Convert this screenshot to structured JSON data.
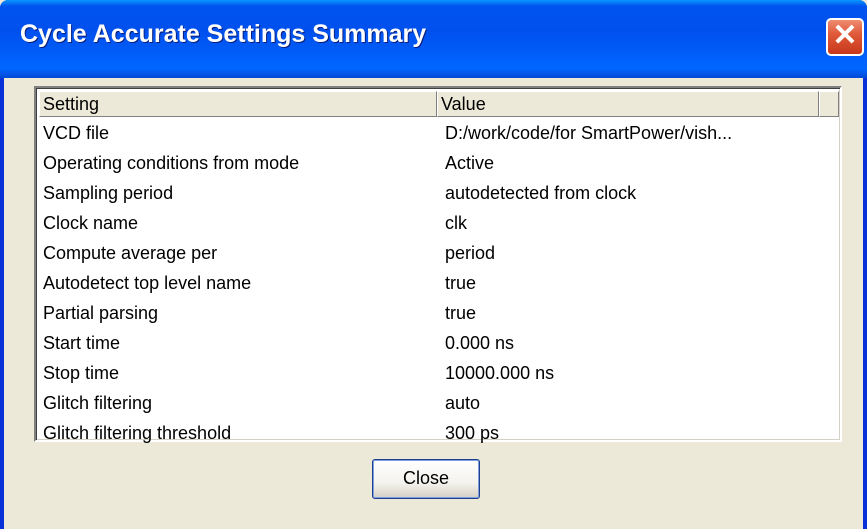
{
  "window": {
    "title": "Cycle Accurate Settings Summary",
    "close_glyph": "✕"
  },
  "table": {
    "columns": [
      "Setting",
      "Value",
      ""
    ],
    "rows": [
      {
        "setting": "VCD file",
        "value": "D:/work/code/for SmartPower/vish..."
      },
      {
        "setting": "Operating conditions from mode",
        "value": "Active"
      },
      {
        "setting": "Sampling period",
        "value": "autodetected from clock"
      },
      {
        "setting": "Clock name",
        "value": "clk"
      },
      {
        "setting": "Compute average per",
        "value": "period"
      },
      {
        "setting": "Autodetect top level name",
        "value": "true"
      },
      {
        "setting": "Partial parsing",
        "value": "true"
      },
      {
        "setting": "Start time",
        "value": "0.000 ns"
      },
      {
        "setting": "Stop time",
        "value": "10000.000 ns"
      },
      {
        "setting": "Glitch filtering",
        "value": "auto"
      },
      {
        "setting": "Glitch filtering threshold",
        "value": "300 ps"
      }
    ]
  },
  "buttons": {
    "close_label": "Close"
  },
  "colors": {
    "titlebar": "#0053ee",
    "close_button": "#e05a3a",
    "dialog_bg": "#ece9d8"
  }
}
